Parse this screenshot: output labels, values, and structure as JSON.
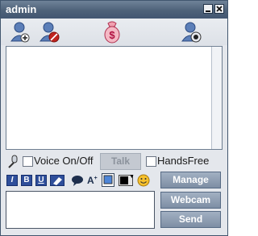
{
  "window": {
    "title": "admin"
  },
  "toolbar": {
    "icons": [
      "add-user-icon",
      "block-user-icon",
      "money-icon",
      "webcam-user-icon"
    ]
  },
  "voice": {
    "voice_label": "Voice On/Off",
    "voice_checked": false,
    "talk_label": "Talk",
    "handsfree_label": "HandsFree",
    "handsfree_checked": false
  },
  "format": {
    "italic": "I",
    "bold": "B",
    "underline": "U"
  },
  "actions": {
    "manage": "Manage",
    "webcam": "Webcam",
    "send": "Send"
  },
  "input": {
    "value": ""
  }
}
